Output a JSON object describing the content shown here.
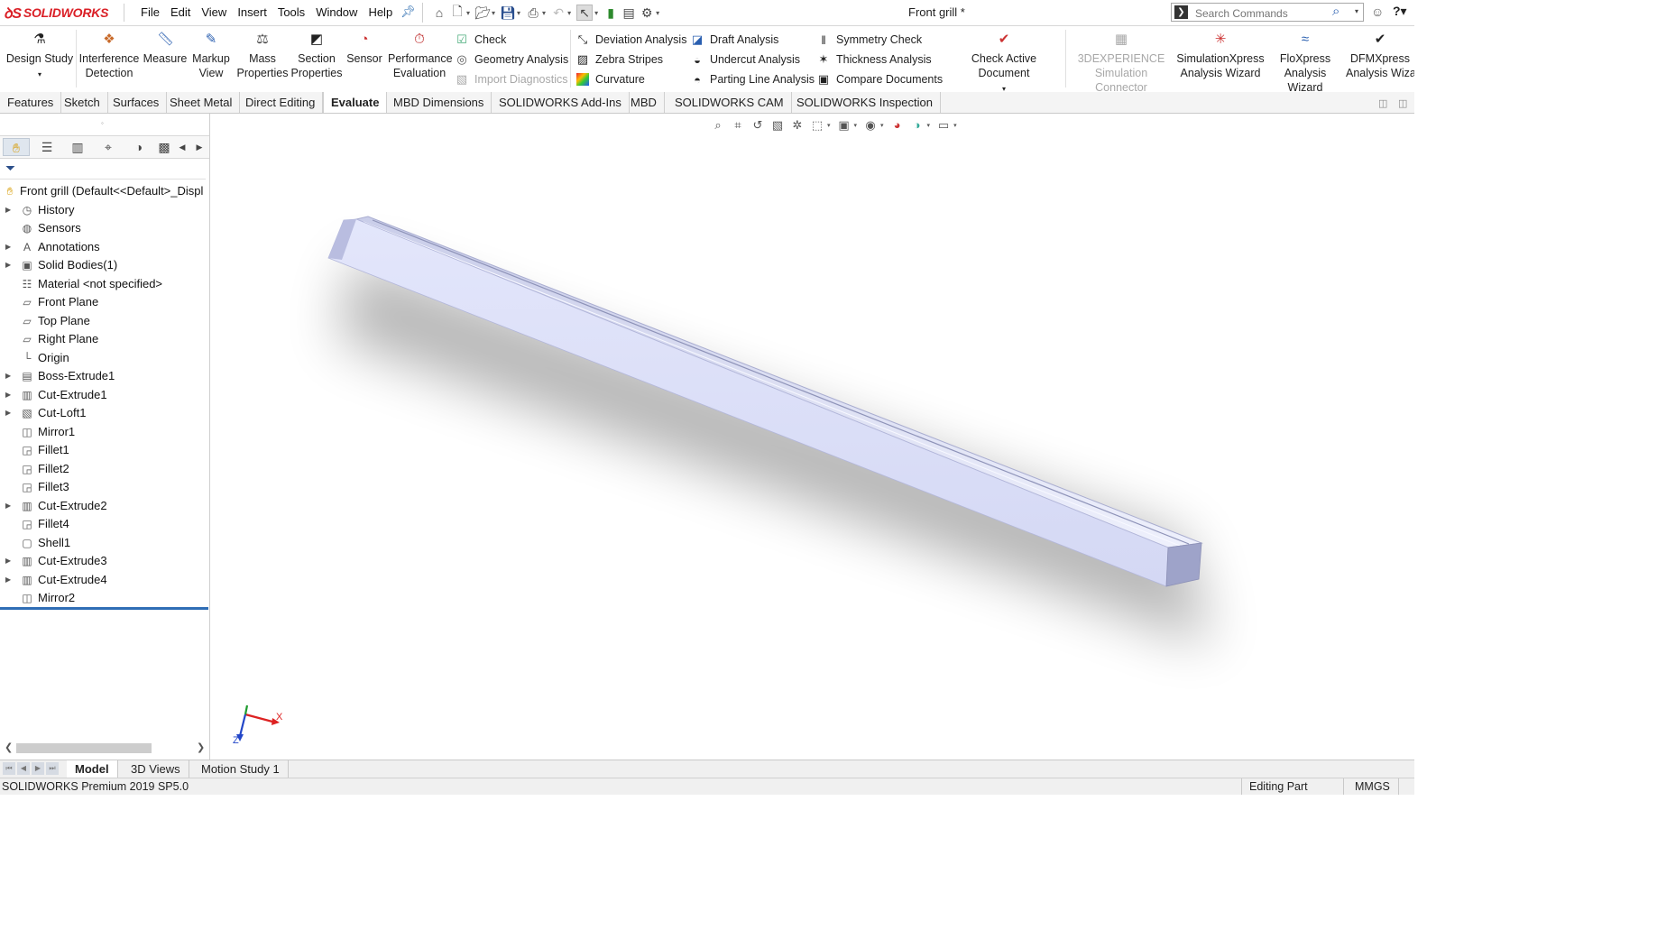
{
  "app": {
    "brand": "SOLIDWORKS",
    "doc_title": "Front grill *"
  },
  "menu": [
    "File",
    "Edit",
    "View",
    "Insert",
    "Tools",
    "Window",
    "Help"
  ],
  "search": {
    "placeholder": "Search Commands"
  },
  "ribbon": {
    "large": [
      {
        "id": "design-study",
        "l1": "Design Study",
        "l2": "",
        "icon": "design-study-icon"
      },
      {
        "id": "interference-detection",
        "l1": "Interference",
        "l2": "Detection",
        "icon": "interference-icon"
      },
      {
        "id": "measure",
        "l1": "Measure",
        "l2": "",
        "icon": "measure-icon"
      },
      {
        "id": "markup-view",
        "l1": "Markup",
        "l2": "View",
        "icon": "markup-icon"
      },
      {
        "id": "mass-properties",
        "l1": "Mass",
        "l2": "Properties",
        "icon": "mass-properties-icon"
      },
      {
        "id": "section-properties",
        "l1": "Section",
        "l2": "Properties",
        "icon": "section-properties-icon"
      },
      {
        "id": "sensor",
        "l1": "Sensor",
        "l2": "",
        "icon": "sensor-icon"
      },
      {
        "id": "performance-evaluation",
        "l1": "Performance",
        "l2": "Evaluation",
        "icon": "performance-icon"
      },
      {
        "id": "check-active-document",
        "l1": "Check Active Document",
        "l2": "",
        "icon": "check-active-icon"
      },
      {
        "id": "3dexperience",
        "l1": "3DEXPERIENCE",
        "l2": "Simulation Connector",
        "icon": "3dx-icon"
      },
      {
        "id": "simulationxpress",
        "l1": "SimulationXpress",
        "l2": "Analysis Wizard",
        "icon": "simxpress-icon"
      },
      {
        "id": "floxpress",
        "l1": "FloXpress",
        "l2": "Analysis Wizard",
        "icon": "floxpress-icon"
      },
      {
        "id": "dfmxpress",
        "l1": "DFMXpress",
        "l2": "Analysis Wizard",
        "icon": "dfmxpress-icon"
      }
    ],
    "small": [
      "Check",
      "Geometry Analysis",
      "Import Diagnostics",
      "Deviation Analysis",
      "Zebra Stripes",
      "Curvature",
      "Draft Analysis",
      "Undercut Analysis",
      "Parting Line Analysis",
      "Symmetry Check",
      "Thickness Analysis",
      "Compare Documents"
    ]
  },
  "tabs": [
    "Features",
    "Sketch",
    "Surfaces",
    "Sheet Metal",
    "Direct Editing",
    "Evaluate",
    "MBD Dimensions",
    "SOLIDWORKS Add-Ins",
    "MBD",
    "SOLIDWORKS CAM",
    "SOLIDWORKS Inspection"
  ],
  "active_tab": "Evaluate",
  "tree": {
    "root": "Front grill  (Default<<Default>_Displ",
    "items": [
      {
        "label": "History",
        "expandable": true,
        "icon": "history-icon"
      },
      {
        "label": "Sensors",
        "expandable": false,
        "icon": "sensors-icon"
      },
      {
        "label": "Annotations",
        "expandable": true,
        "icon": "annotations-icon"
      },
      {
        "label": "Solid Bodies(1)",
        "expandable": true,
        "icon": "solid-bodies-icon"
      },
      {
        "label": "Material <not specified>",
        "expandable": false,
        "icon": "material-icon"
      },
      {
        "label": "Front Plane",
        "expandable": false,
        "icon": "plane-icon"
      },
      {
        "label": "Top Plane",
        "expandable": false,
        "icon": "plane-icon"
      },
      {
        "label": "Right Plane",
        "expandable": false,
        "icon": "plane-icon"
      },
      {
        "label": "Origin",
        "expandable": false,
        "icon": "origin-icon"
      },
      {
        "label": "Boss-Extrude1",
        "expandable": true,
        "icon": "extrude-icon"
      },
      {
        "label": "Cut-Extrude1",
        "expandable": true,
        "icon": "cut-extrude-icon"
      },
      {
        "label": "Cut-Loft1",
        "expandable": true,
        "icon": "cut-loft-icon"
      },
      {
        "label": "Mirror1",
        "expandable": false,
        "icon": "mirror-icon"
      },
      {
        "label": "Fillet1",
        "expandable": false,
        "icon": "fillet-icon"
      },
      {
        "label": "Fillet2",
        "expandable": false,
        "icon": "fillet-icon"
      },
      {
        "label": "Fillet3",
        "expandable": false,
        "icon": "fillet-icon"
      },
      {
        "label": "Cut-Extrude2",
        "expandable": true,
        "icon": "cut-extrude-icon"
      },
      {
        "label": "Fillet4",
        "expandable": false,
        "icon": "fillet-icon"
      },
      {
        "label": "Shell1",
        "expandable": false,
        "icon": "shell-icon"
      },
      {
        "label": "Cut-Extrude3",
        "expandable": true,
        "icon": "cut-extrude-icon"
      },
      {
        "label": "Cut-Extrude4",
        "expandable": true,
        "icon": "cut-extrude-icon"
      },
      {
        "label": "Mirror2",
        "expandable": false,
        "icon": "mirror-icon"
      }
    ]
  },
  "triad": {
    "x": "X",
    "z": "Z"
  },
  "bottom_tabs": [
    "Model",
    "3D Views",
    "Motion Study 1"
  ],
  "active_bottom_tab": "Model",
  "status": {
    "version": "SOLIDWORKS Premium 2019 SP5.0",
    "mode": "Editing Part",
    "units": "MMGS"
  },
  "colors": {
    "brand_red": "#da1f26",
    "part_face": "#dfe3fb",
    "rollback_bar": "#2f6db5"
  }
}
